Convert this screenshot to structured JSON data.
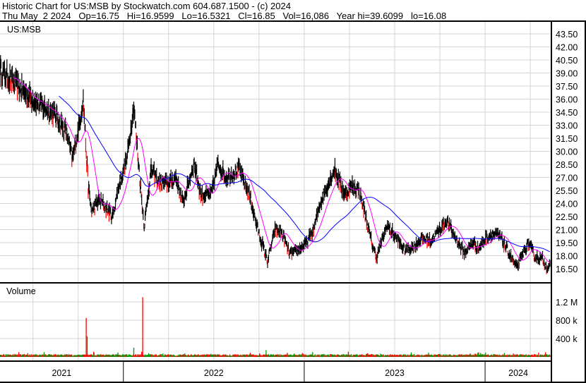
{
  "header": {
    "title": "Historic Chart for US:MSB by Stockwatch.com 604.687.1500 - (c) 2024",
    "quote": "Thu May  2 2024   Op=16.75   Hi=16.9599   Lo=16.5321   Cl=16.85   Vol=16,086   Year hi=39.6099   lo=16.08"
  },
  "chart_data": {
    "type": "line",
    "symbol_label": "US:MSB",
    "volume_label": "Volume",
    "price_ticks": [
      "43.50",
      "42.00",
      "40.50",
      "39.00",
      "37.50",
      "36.00",
      "34.50",
      "33.00",
      "31.50",
      "30.00",
      "28.50",
      "27.00",
      "25.50",
      "24.00",
      "22.50",
      "21.00",
      "19.50",
      "18.00",
      "16.50"
    ],
    "ylim": [
      15.6,
      44.7
    ],
    "volume_ticks": [
      "1.2 M",
      "800 k",
      "400 k"
    ],
    "volume_tick_values": [
      1200000,
      800000,
      400000
    ],
    "x_labels": [
      "2021",
      "2022",
      "2023",
      "2024"
    ],
    "x_days_range": [
      0,
      1110
    ],
    "year_start_days": [
      -116,
      249,
      614,
      979
    ],
    "price_keypoints_days_price": [
      [
        0,
        39.3
      ],
      [
        28,
        37.8
      ],
      [
        57,
        36.4
      ],
      [
        85,
        35.2
      ],
      [
        114,
        34
      ],
      [
        135,
        32
      ],
      [
        146,
        29.1
      ],
      [
        160,
        33
      ],
      [
        168,
        36
      ],
      [
        178,
        26
      ],
      [
        185,
        23
      ],
      [
        200,
        24.5
      ],
      [
        227,
        22.5
      ],
      [
        240,
        26
      ],
      [
        256,
        29.1
      ],
      [
        270,
        35.2
      ],
      [
        285,
        25
      ],
      [
        291,
        21.4
      ],
      [
        305,
        27.9
      ],
      [
        320,
        26.5
      ],
      [
        341,
        26.3
      ],
      [
        355,
        27
      ],
      [
        369,
        24
      ],
      [
        392,
        28.7
      ],
      [
        405,
        25
      ],
      [
        426,
        25
      ],
      [
        440,
        28.6
      ],
      [
        455,
        27
      ],
      [
        483,
        27.9
      ],
      [
        505,
        24.7
      ],
      [
        520,
        21
      ],
      [
        540,
        17.4
      ],
      [
        555,
        21
      ],
      [
        568,
        20.7
      ],
      [
        585,
        18.2
      ],
      [
        598,
        18.5
      ],
      [
        618,
        19.4
      ],
      [
        633,
        21
      ],
      [
        646,
        24
      ],
      [
        675,
        27.9
      ],
      [
        696,
        25
      ],
      [
        710,
        26
      ],
      [
        725,
        25.5
      ],
      [
        740,
        22
      ],
      [
        750,
        19.5
      ],
      [
        760,
        17.8
      ],
      [
        781,
        21.5
      ],
      [
        800,
        20
      ],
      [
        816,
        18.7
      ],
      [
        835,
        19
      ],
      [
        852,
        20
      ],
      [
        870,
        19.7
      ],
      [
        880,
        20.5
      ],
      [
        902,
        22
      ],
      [
        915,
        20.5
      ],
      [
        937,
        18.3
      ],
      [
        955,
        19.5
      ],
      [
        966,
        18.8
      ],
      [
        980,
        20
      ],
      [
        994,
        20.5
      ],
      [
        1010,
        20.2
      ],
      [
        1025,
        18.5
      ],
      [
        1043,
        16.6
      ],
      [
        1060,
        18.8
      ],
      [
        1067,
        19.4
      ],
      [
        1080,
        17.8
      ],
      [
        1095,
        17.6
      ],
      [
        1105,
        16.6
      ],
      [
        1109,
        16.85
      ]
    ],
    "volume_spikes_days_value": [
      [
        174,
        850000
      ],
      [
        176,
        450000
      ],
      [
        270,
        200000
      ],
      [
        288,
        1300000
      ],
      [
        300,
        80000
      ],
      [
        537,
        150000
      ],
      [
        966,
        100000
      ]
    ],
    "series": [
      {
        "name": "Price",
        "color": "#000000"
      },
      {
        "name": "Short moving average",
        "color": "#ff00ff"
      },
      {
        "name": "Long moving average",
        "color": "#0000ff"
      },
      {
        "name": "Volume up",
        "color": "#009900"
      },
      {
        "name": "Volume down",
        "color": "#ff0000"
      }
    ]
  }
}
